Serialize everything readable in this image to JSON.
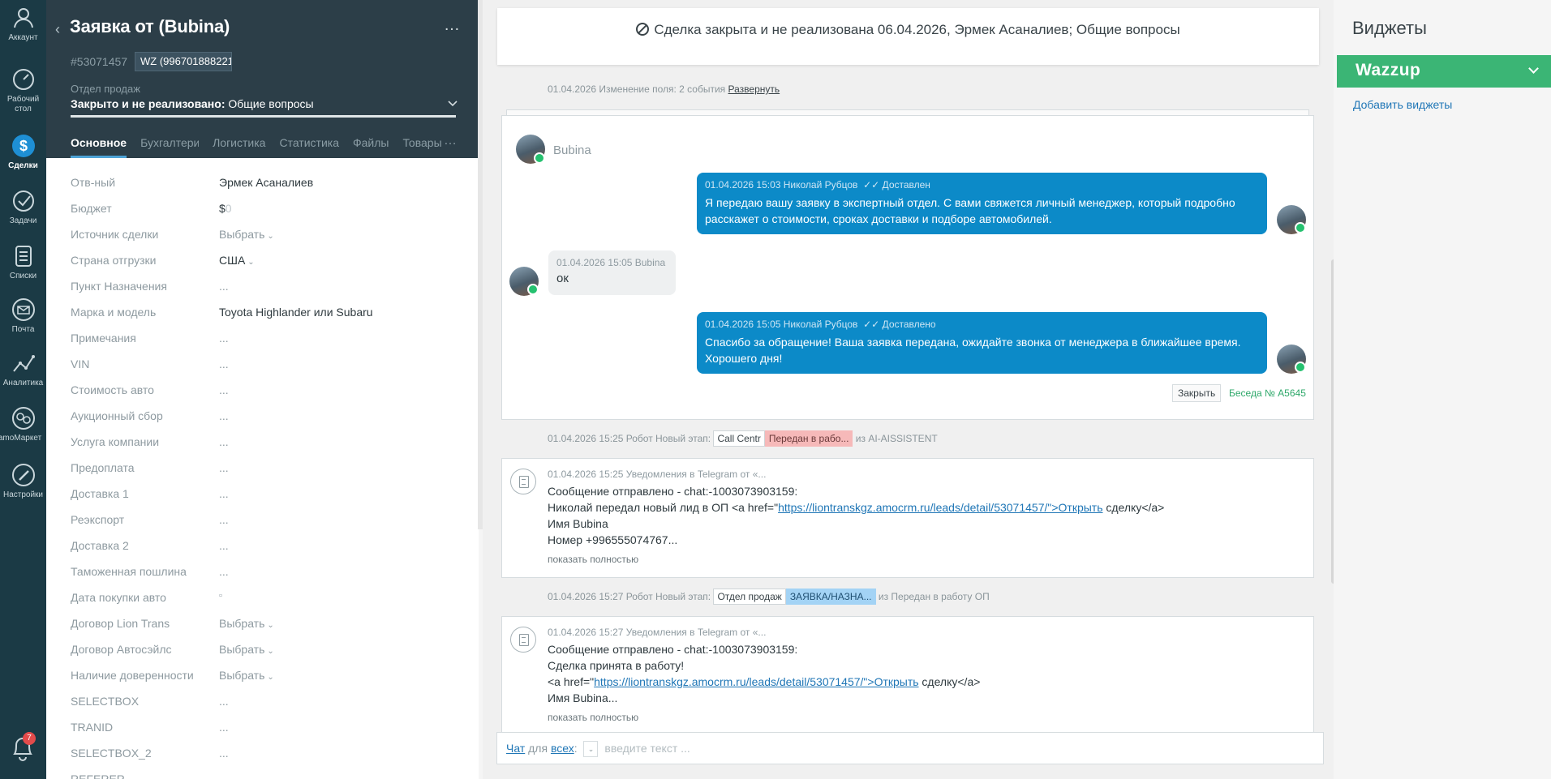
{
  "rail": {
    "items": [
      {
        "label": "Аккаунт",
        "icon": "account-icon"
      },
      {
        "label": "Рабочий стол",
        "icon": "dashboard-icon"
      },
      {
        "label": "Сделки",
        "icon": "deals-icon"
      },
      {
        "label": "Задачи",
        "icon": "tasks-icon"
      },
      {
        "label": "Списки",
        "icon": "lists-icon"
      },
      {
        "label": "Почта",
        "icon": "mail-icon"
      },
      {
        "label": "Аналитика",
        "icon": "analytics-icon"
      },
      {
        "label": "amoМаркет",
        "icon": "market-icon"
      },
      {
        "label": "Настройки",
        "icon": "settings-icon"
      }
    ],
    "notifications_count": "7"
  },
  "lead": {
    "title": "Заявка от (Bubina)",
    "id": "#53071457",
    "tag": "WZ (996701888221",
    "pipeline": "Отдел продаж",
    "stage_bold": "Закрыто и не реализовано:",
    "stage_rest": " Общие вопросы",
    "tabs": [
      "Основное",
      "Бухгалтерия",
      "Логистика",
      "Статистика",
      "Файлы",
      "Товары"
    ],
    "fields": [
      {
        "label": "Отв-ный",
        "value": "Эрмек Асаналиев"
      },
      {
        "label": "Бюджет",
        "value": "$"
      },
      {
        "label": "Источник сделки",
        "value": "Выбрать"
      },
      {
        "label": "Страна отгрузки",
        "value": "США"
      },
      {
        "label": "Пункт Назначения",
        "value": "..."
      },
      {
        "label": "Марка и модель",
        "value": "Toyota Highlander или Subaru"
      },
      {
        "label": "Примечания",
        "value": "..."
      },
      {
        "label": "VIN",
        "value": "..."
      },
      {
        "label": "Стоимость авто",
        "value": "..."
      },
      {
        "label": "Аукционный сбор",
        "value": "..."
      },
      {
        "label": "Услуга компании",
        "value": "..."
      },
      {
        "label": "Предоплата",
        "value": "..."
      },
      {
        "label": "Доставка 1",
        "value": "..."
      },
      {
        "label": "Реэкспорт",
        "value": "..."
      },
      {
        "label": "Доставка 2",
        "value": "..."
      },
      {
        "label": "Таможенная пошлина",
        "value": "..."
      },
      {
        "label": "Дата покупки авто",
        "value": "▫"
      },
      {
        "label": "Договор Lion Trans",
        "value": "Выбрать"
      },
      {
        "label": "Договор Автосэйлс",
        "value": "Выбрать"
      },
      {
        "label": "Наличие довереннoсти",
        "value": "Выбрать"
      },
      {
        "label": "SELECTBOX",
        "value": "..."
      },
      {
        "label": "TRANID",
        "value": "..."
      },
      {
        "label": "SELECTBOX_2",
        "value": "..."
      },
      {
        "label": "REFERER",
        "value": ""
      }
    ],
    "budget_zero": "0"
  },
  "feed": {
    "closed_banner": "Сделка закрыта и не реализована 06.04.2026, Эрмек Асаналиев; Общие вопросы",
    "field_change_note": "01.04.2026 Изменение поля: 2 события",
    "expand_link": "Развернуть",
    "contact_name": "Bubina",
    "messages": [
      {
        "meta": "01.04.2026 15:03 Николай Рубцов",
        "status": "✓✓ Доставлен",
        "text_1": "Я передаю вашу заявку в экспертный отдел. С вами свяжется личный менеджер, который подробно",
        "text_2": "расскажет о стоимости, сроках доставки и подборе автомобилей."
      },
      {
        "meta": "01.04.2026 15:05 Bubina",
        "text": "ок"
      },
      {
        "meta": "01.04.2026 15:05 Николай Рубцов",
        "status": "✓✓ Доставлено",
        "text_1": "Спасибо за обращение! Ваша заявка передана, ожидайте звонка от менеджера в ближайшее время.",
        "text_2": "Хорошего дня!"
      }
    ],
    "close_button": "Закрыть",
    "conversation_link": "Беседа № A5645",
    "robot_1": {
      "prefix": "01.04.2026 15:25 Робот Новый этап:",
      "chip_a": "Call Centr",
      "chip_b": "Передан в рабо...",
      "suffix": "из AI-AISSISTENT"
    },
    "tg_1": {
      "meta": "01.04.2026 15:25 Уведомления в Telegram от «...",
      "line_1": "Сообщение отправлено - chat:-1003073903159:",
      "line_2_pre": "Николай передал новый лид в ОП <a href=\"",
      "line_2_link": "https://liontranskgz.amocrm.ru/leads/detail/53071457/\">Открыть",
      "line_2_post": " сделку</a>",
      "line_3": "Имя Bubina",
      "line_4": "Номер +996555074767...",
      "show_full": "показать полностью"
    },
    "robot_2": {
      "prefix": "01.04.2026 15:27 Робот Новый этап:",
      "chip_a": "Отдел продаж",
      "chip_b": "ЗАЯВКА/НАЗНА...",
      "suffix": "из Передан в работу ОП"
    },
    "tg_2": {
      "meta": "01.04.2026 15:27 Уведомления в Telegram от «...",
      "line_1": "Сообщение отправлено - chat:-1003073903159:",
      "line_2": "Сделка принята в работу!",
      "line_3_pre": "<a href=\"",
      "line_3_link": "https://liontranskgz.amocrm.ru/leads/detail/53071457/\">Открыть",
      "line_3_post": " сделку</a>",
      "line_4": "Имя Bubina...",
      "show_full": "показать полностью"
    },
    "chat_input": {
      "chat": "Чат",
      "for": "для",
      "all": "всех",
      "placeholder": "введите текст ..."
    }
  },
  "widgets": {
    "title": "Виджеты",
    "wazzup": "Wazzup",
    "add": "Добавить виджеты"
  },
  "colors": {
    "rail": "#1b3a45",
    "lead_head": "#2c3e48",
    "bubble": "#0c8ac8",
    "wazzup": "#3bb575"
  }
}
